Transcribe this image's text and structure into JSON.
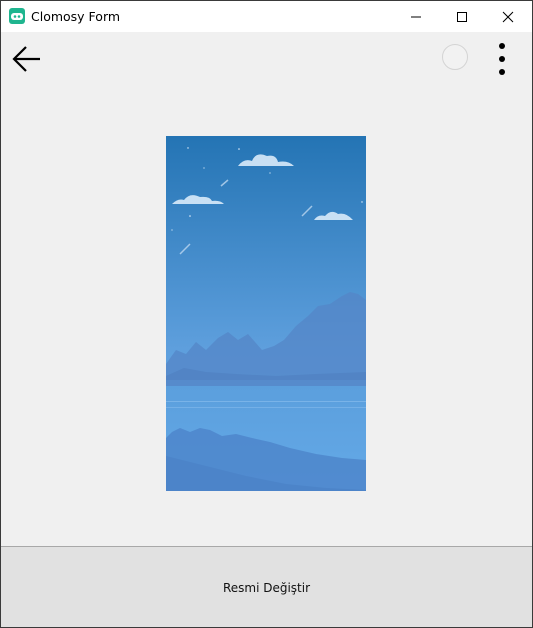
{
  "window": {
    "title": "Clomosy Form",
    "icon": "clomosy-app-icon",
    "controls": [
      "minimize-icon",
      "maximize-icon",
      "close-icon"
    ]
  },
  "toolbar": {
    "back_icon": "arrow-left-icon",
    "status_icon": "circle-icon",
    "menu_icon": "more-vertical-icon"
  },
  "image": {
    "description_icon": "sky-landscape-image",
    "colors": {
      "sky_top": "#2474b4",
      "sky_mid": "#5e9fdd",
      "water": "#63a8e6"
    }
  },
  "action_button": {
    "label": "Resmi Değiştir"
  }
}
